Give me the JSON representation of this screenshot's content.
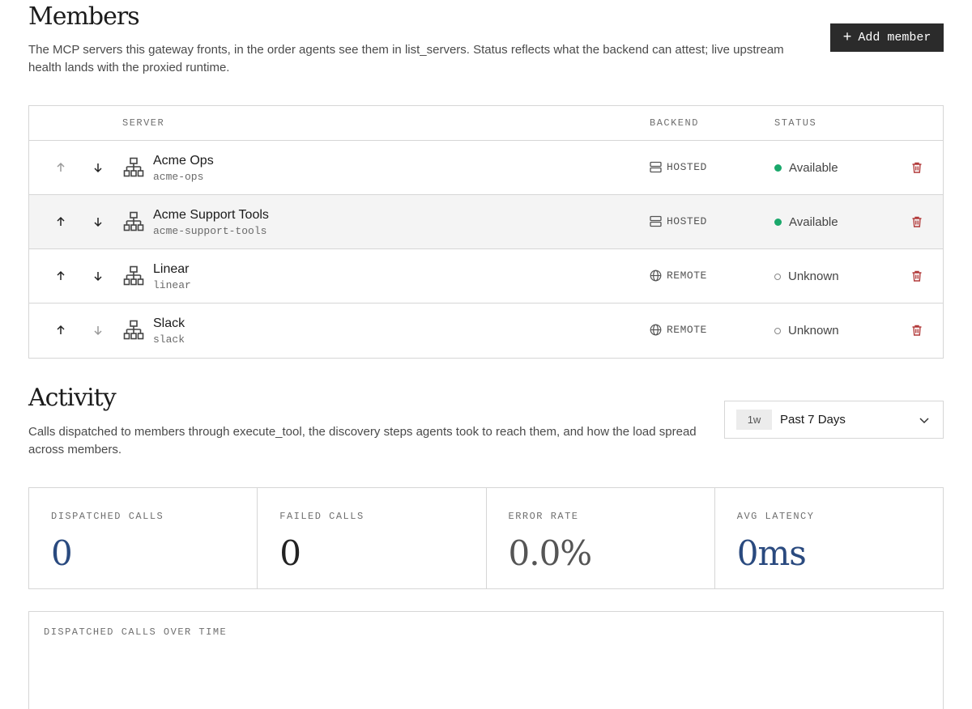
{
  "members": {
    "title": "Members",
    "description": "The MCP servers this gateway fronts, in the order agents see them in list_servers. Status reflects what the backend can attest; live upstream health lands with the proxied runtime.",
    "add_button_label": "Add member",
    "columns": {
      "server": "SERVER",
      "backend": "BACKEND",
      "status": "STATUS"
    },
    "rows": [
      {
        "name": "Acme Ops",
        "slug": "acme-ops",
        "backend": "HOSTED",
        "backend_icon": "server-icon",
        "status": "Available",
        "status_kind": "available",
        "up_enabled": false,
        "down_enabled": true
      },
      {
        "name": "Acme Support Tools",
        "slug": "acme-support-tools",
        "backend": "HOSTED",
        "backend_icon": "server-icon",
        "status": "Available",
        "status_kind": "available",
        "up_enabled": true,
        "down_enabled": true
      },
      {
        "name": "Linear",
        "slug": "linear",
        "backend": "REMOTE",
        "backend_icon": "globe-icon",
        "status": "Unknown",
        "status_kind": "unknown",
        "up_enabled": true,
        "down_enabled": true
      },
      {
        "name": "Slack",
        "slug": "slack",
        "backend": "REMOTE",
        "backend_icon": "globe-icon",
        "status": "Unknown",
        "status_kind": "unknown",
        "up_enabled": true,
        "down_enabled": false
      }
    ]
  },
  "activity": {
    "title": "Activity",
    "description": "Calls dispatched to members through execute_tool, the discovery steps agents took to reach them, and how the load spread across members.",
    "range": {
      "short": "1w",
      "label": "Past 7 Days"
    },
    "metrics": [
      {
        "label": "DISPATCHED CALLS",
        "value": "0"
      },
      {
        "label": "FAILED CALLS",
        "value": "0"
      },
      {
        "label": "ERROR RATE",
        "value": "0.0%"
      },
      {
        "label": "AVG LATENCY",
        "value": "0ms"
      }
    ],
    "chart_title": "DISPATCHED CALLS OVER TIME"
  },
  "colors": {
    "available": "#1aa86b",
    "danger": "#b23a3a",
    "accent_blue": "#2a4a7f",
    "button_bg": "#2b2b2b"
  }
}
